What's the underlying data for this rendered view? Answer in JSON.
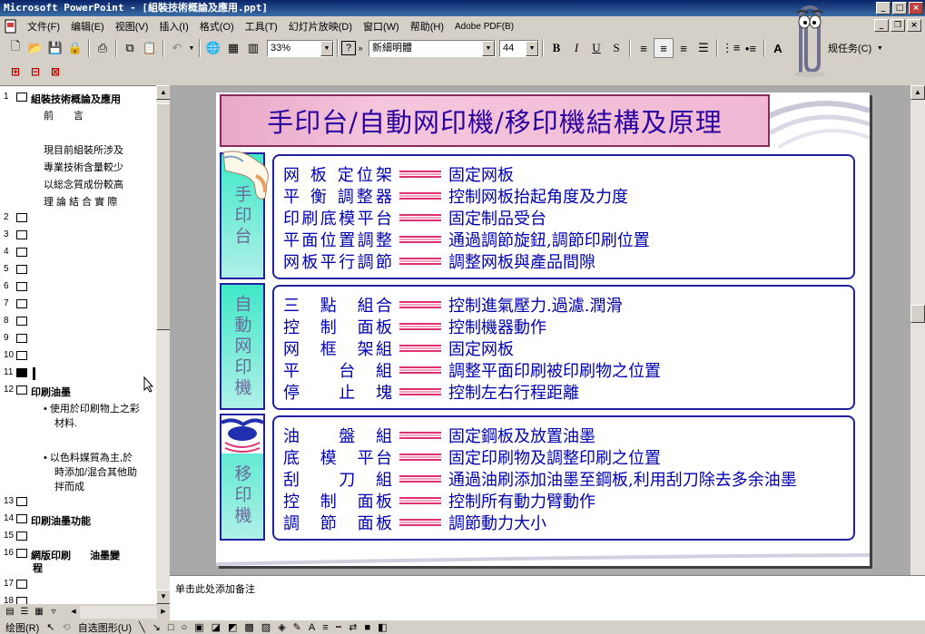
{
  "window": {
    "title": "Microsoft PowerPoint - [組裝技術概論及應用.ppt]"
  },
  "menu": {
    "items": [
      "文件(F)",
      "编辑(E)",
      "视图(V)",
      "插入(I)",
      "格式(O)",
      "工具(T)",
      "幻灯片放映(D)",
      "窗口(W)",
      "帮助(H)",
      "Adobe PDF(B)"
    ]
  },
  "toolbar": {
    "zoom": "33%",
    "font_name": "新細明體",
    "font_size": "44",
    "task_label": "规任务(C)"
  },
  "outline": {
    "slide1_title": "組裝技術概論及應用",
    "slide1_lines": [
      "前　　言",
      "",
      "現目前組裝所涉及",
      "專業技術含量較少",
      "以総念質成份較高",
      "理 論 結 合 實 際"
    ],
    "numbers": [
      "1",
      "2",
      "3",
      "4",
      "5",
      "6",
      "7",
      "8",
      "9",
      "10",
      "11",
      "12",
      "13",
      "14",
      "15",
      "16",
      "17",
      "18"
    ],
    "slide12_title": "印刷油墨",
    "slide12_bullet1": "• 使用於印刷物上之彩色材料.",
    "slide12_bullet1_lines": [
      "• 使用於印刷物上之彩",
      "材料."
    ],
    "slide12_bullet2_lines": [
      "• 以色料媒質為主,於",
      "時添加/混合其他助",
      "拌而成"
    ],
    "slide14_title": "印刷油墨功能",
    "slide16_title_a": "網版印刷",
    "slide16_title_b": "油墨變",
    "slide16_title_c": "程"
  },
  "slide": {
    "title": "手印台/自動网印機/移印機結構及原理",
    "sections": [
      {
        "label": "手印台",
        "rows": [
          {
            "name": "网 板 定位架",
            "desc": "固定网板"
          },
          {
            "name": "平 衡 調整器",
            "desc": "控制网板抬起角度及力度"
          },
          {
            "name": "印刷底模平台",
            "desc": "固定制品受台"
          },
          {
            "name": "平面位置調整",
            "desc": "通過調節旋鈕,調節印刷位置"
          },
          {
            "name": "网板平行調節",
            "desc": "調整网板與產品間隙"
          }
        ]
      },
      {
        "label": "自動网印機",
        "rows": [
          {
            "name": "三　點　組合",
            "desc": "控制進氣壓力.過濾.潤滑"
          },
          {
            "name": "控　制　面板",
            "desc": "控制機器動作"
          },
          {
            "name": "网　框　架組",
            "desc": "固定网板"
          },
          {
            "name": "平　　台　組",
            "desc": "調整平面印刷被印刷物之位置"
          },
          {
            "name": "停　　止　塊",
            "desc": "控制左右行程距離"
          }
        ]
      },
      {
        "label": "移印機",
        "rows": [
          {
            "name": "油　　盤　組",
            "desc": "固定鋼板及放置油墨"
          },
          {
            "name": "底　模　平台",
            "desc": "固定印刷物及調整印刷之位置"
          },
          {
            "name": "刮　　刀　組",
            "desc": "通過油刷添加油墨至鋼板,利用刮刀除去多余油墨"
          },
          {
            "name": "控　制　面板",
            "desc": "控制所有動力臂動作"
          },
          {
            "name": "調　節　面板",
            "desc": "調節動力大小"
          }
        ]
      }
    ]
  },
  "notes": {
    "placeholder": "单击此处添加备注"
  },
  "drawbar": {
    "draw_label": "绘图(R)",
    "autoshape_label": "自选图形(U)"
  }
}
